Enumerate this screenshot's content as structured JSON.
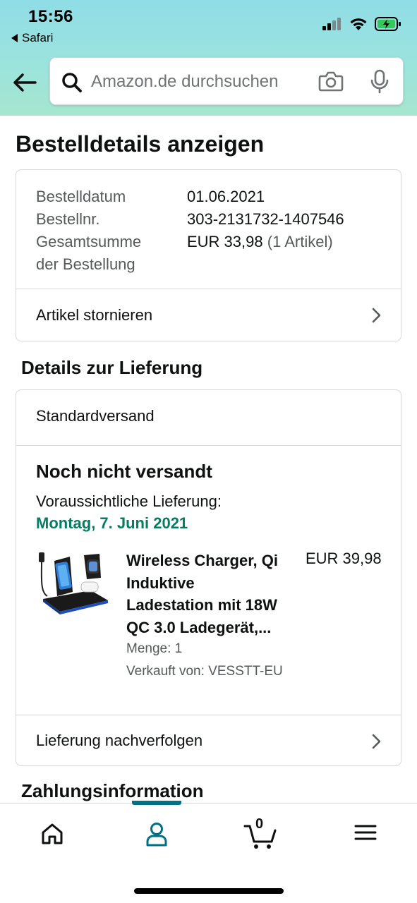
{
  "status_bar": {
    "time": "15:56",
    "back_app": "Safari"
  },
  "search": {
    "placeholder": "Amazon.de durchsuchen"
  },
  "page_title": "Bestelldetails anzeigen",
  "order_summary": {
    "rows": [
      {
        "label": "Bestelldatum",
        "value": "01.06.2021"
      },
      {
        "label": "Bestellnr.",
        "value": "303-2131732-1407546"
      }
    ],
    "total_label_line1": "Gesamtsumme",
    "total_label_line2": "der Bestellung",
    "total_value": "EUR 33,98",
    "total_items": "(1 Artikel)",
    "cancel_link": "Artikel stornieren"
  },
  "delivery": {
    "section_title": "Details zur Lieferung",
    "shipping_method": "Standardversand",
    "status": "Noch nicht versandt",
    "estimated_label": "Voraussichtliche Lieferung:",
    "estimated_date": "Montag, 7. Juni 2021",
    "product": {
      "title_line1": "Wireless Charger, Qi",
      "title_line2": "Induktive",
      "title_line3": "Ladestation mit 18W",
      "title_line4": "QC 3.0 Ladegerät,...",
      "price": "EUR 39,98",
      "quantity": "Menge: 1",
      "seller": "Verkauft von: VESSTT-EU"
    },
    "track_link": "Lieferung nachverfolgen"
  },
  "payment_section_title": "Zahlungsinformation",
  "tabbar": {
    "active_tab": "account",
    "cart_count": "0",
    "accent_color": "#007185"
  },
  "colors": {
    "delivery_date": "#067d62",
    "header_gradient_top": "#8fdde6",
    "header_gradient_bottom": "#a6e6ce"
  }
}
